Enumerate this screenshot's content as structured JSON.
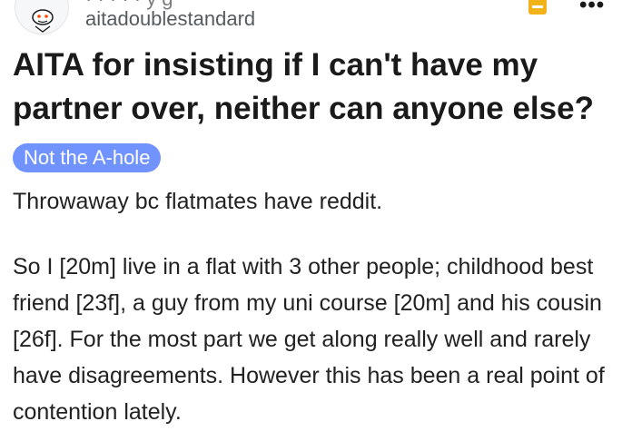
{
  "post": {
    "author": "aitadoublestandard",
    "clipped_header_text": "· · · · ·   y   g",
    "title": "AITA for insisting if I can't have my partner over, neither can anyone else?",
    "flair": "Not the A-hole",
    "body": [
      "Throwaway bc flatmates have reddit.",
      "So I [20m] live in a flat with 3 other people; childhood best friend [23f], a guy from my uni course [20m] and his cousin [26f]. For the most part we get along really well and rarely have disagreements. However this has been a real point of contention lately."
    ]
  },
  "icons": {
    "avatar": "reddit-snoo-avatar",
    "award": "award-icon",
    "more": "more-options-icon"
  },
  "colors": {
    "flair_background": "#7193ff",
    "flair_text": "#ffffff",
    "award": "#f1b21a",
    "username": "#555b5f"
  }
}
